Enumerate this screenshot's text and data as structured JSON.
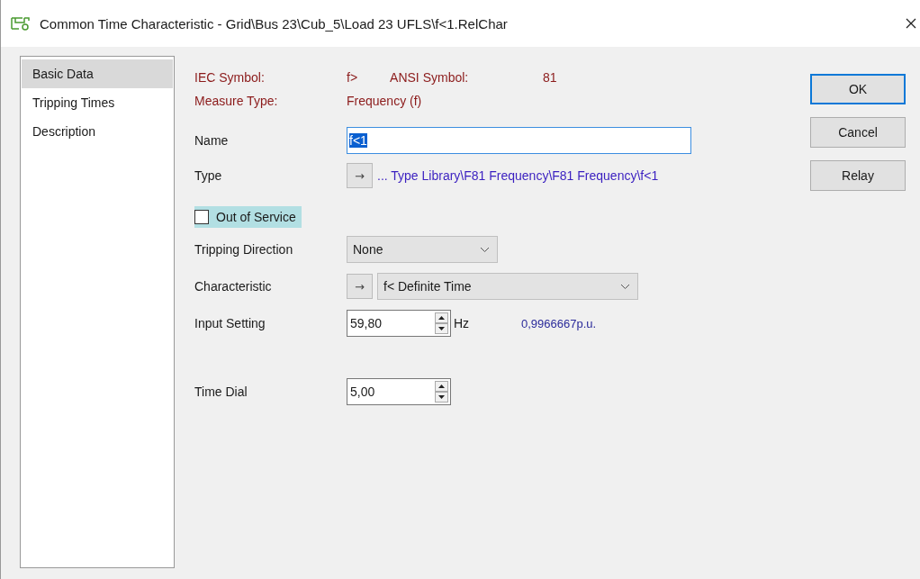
{
  "window": {
    "title": "Common Time Characteristic - Grid\\Bus 23\\Cub_5\\Load 23 UFLS\\f<1.RelChar"
  },
  "sidebar": {
    "items": [
      {
        "label": "Basic Data",
        "selected": true
      },
      {
        "label": "Tripping Times",
        "selected": false
      },
      {
        "label": "Description",
        "selected": false
      }
    ]
  },
  "info": [
    {
      "label": "IEC Symbol:",
      "value": "f>",
      "label_2": "ANSI Symbol:",
      "value_2": "81"
    },
    {
      "label": "Measure Type:",
      "value": "Frequency (f)"
    }
  ],
  "fields": [
    {
      "kind": "text",
      "label": "Name",
      "value": "f<1",
      "text_selected": true
    },
    {
      "kind": "link",
      "label": "Type",
      "arrow": "→",
      "value": "... Type Library\\F81 Frequency\\F81 Frequency\\f<1"
    },
    {
      "kind": "checkbox",
      "label": "Out of Service",
      "checked": false,
      "focused": true
    },
    {
      "kind": "dropdown",
      "label": "Tripping Direction",
      "value": "None"
    },
    {
      "kind": "link-dropdown",
      "label": "Characteristic",
      "arrow": "→",
      "value": "f< Definite Time"
    },
    {
      "kind": "spinner",
      "label": "Input Setting",
      "value": "59,80",
      "unit": "Hz",
      "reading": "0,9966667p.u."
    },
    {
      "kind": "spinner",
      "label": "Time Dial",
      "value": "5,00"
    }
  ],
  "buttons": [
    {
      "label": "OK",
      "default": true
    },
    {
      "label": "Cancel",
      "default": false
    },
    {
      "label": "Relay",
      "default": false
    }
  ]
}
